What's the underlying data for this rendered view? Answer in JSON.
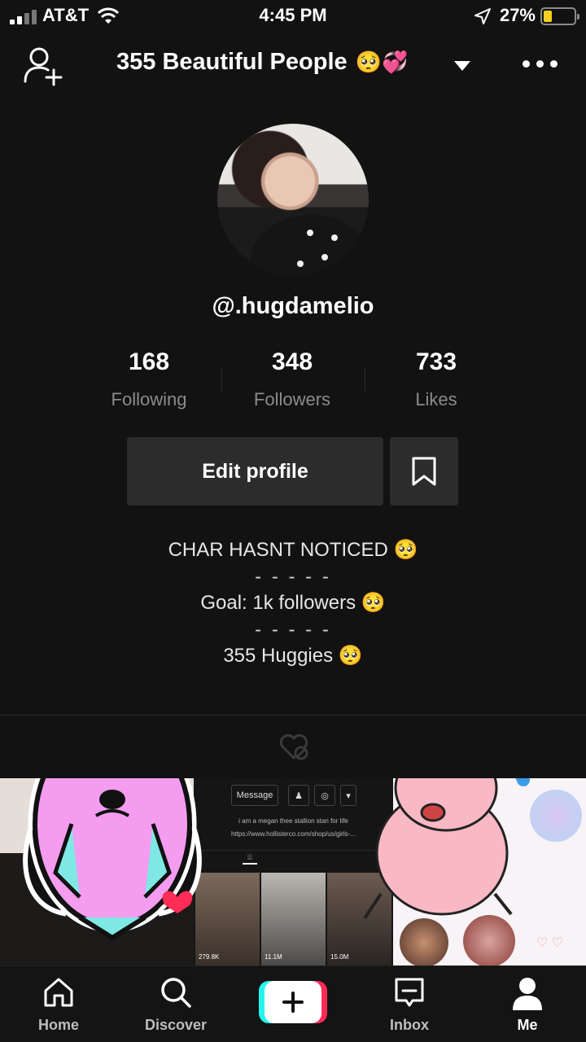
{
  "status_bar": {
    "carrier": "AT&T",
    "time": "4:45 PM",
    "battery": "27%"
  },
  "header": {
    "title": "355 Beautiful People",
    "title_emoji": "🥺💞"
  },
  "profile": {
    "username": "@.hugdamelio",
    "stats": [
      {
        "value": "168",
        "label": "Following"
      },
      {
        "value": "348",
        "label": "Followers"
      },
      {
        "value": "733",
        "label": "Likes"
      }
    ],
    "edit_button": "Edit profile"
  },
  "bio": {
    "line1": "CHAR HASNT NOTICED 🥺",
    "sep1": "- - - - -",
    "line2": "Goal: 1k followers 🥺",
    "sep2": "- - - - -",
    "line3": "355 Huggies 🥺"
  },
  "embedded": {
    "message_button": "Message",
    "bio_text": "i am a megan thee stallion stan for life",
    "link_text": "https://www.hollisterco.com/shop/us/girls-...",
    "thumb_views": [
      "279.8K",
      "11.1M",
      "15.0M"
    ]
  },
  "nav": {
    "home": "Home",
    "discover": "Discover",
    "inbox": "Inbox",
    "me": "Me"
  },
  "colors": {
    "background": "#121212",
    "button_bg": "#2c2c2c",
    "accent_cyan": "#25f4ee",
    "accent_red": "#fe2c55",
    "battery_yellow": "#f5d020"
  }
}
